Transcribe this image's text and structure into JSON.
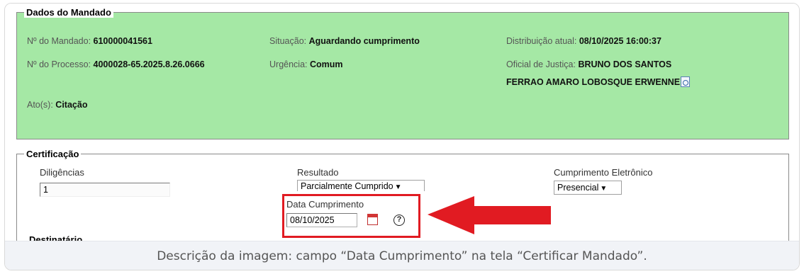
{
  "dados": {
    "legend": "Dados do Mandado",
    "mandado_label": "Nº do Mandado:",
    "mandado_value": "610000041561",
    "situacao_label": "Situação:",
    "situacao_value": "Aguardando cumprimento",
    "distribuicao_label": "Distribuição atual:",
    "distribuicao_value": "08/10/2025 16:00:37",
    "processo_label": "Nº do Processo:",
    "processo_value": "4000028-65.2025.8.26.0666",
    "urgencia_label": "Urgência:",
    "urgencia_value": "Comum",
    "oficial_label": "Oficial de Justiça:",
    "oficial_value_line1": "BRUNO DOS SANTOS",
    "oficial_value_line2": "FERRAO AMARO LOBOSQUE ERWENNE",
    "atos_label": "Ato(s):",
    "atos_value": "Citação"
  },
  "certificacao": {
    "legend": "Certificação",
    "diligencias_label": "Diligências",
    "diligencias_value": "1",
    "resultado_label": "Resultado",
    "resultado_value": "Parcialmente Cumprido",
    "cumprimento_eletronico_label": "Cumprimento Eletrônico",
    "cumprimento_eletronico_value": "Presencial",
    "data_cumprimento_label": "Data Cumprimento",
    "data_cumprimento_value": "08/10/2025",
    "help_glyph": "?",
    "destinatario_label": "Destinatário"
  },
  "caption": "Descrição da imagem: campo “Data Cumprimento” na tela “Certificar Mandado”.",
  "colors": {
    "panel_green": "#a5e8a5",
    "highlight_red": "#e11b22"
  }
}
